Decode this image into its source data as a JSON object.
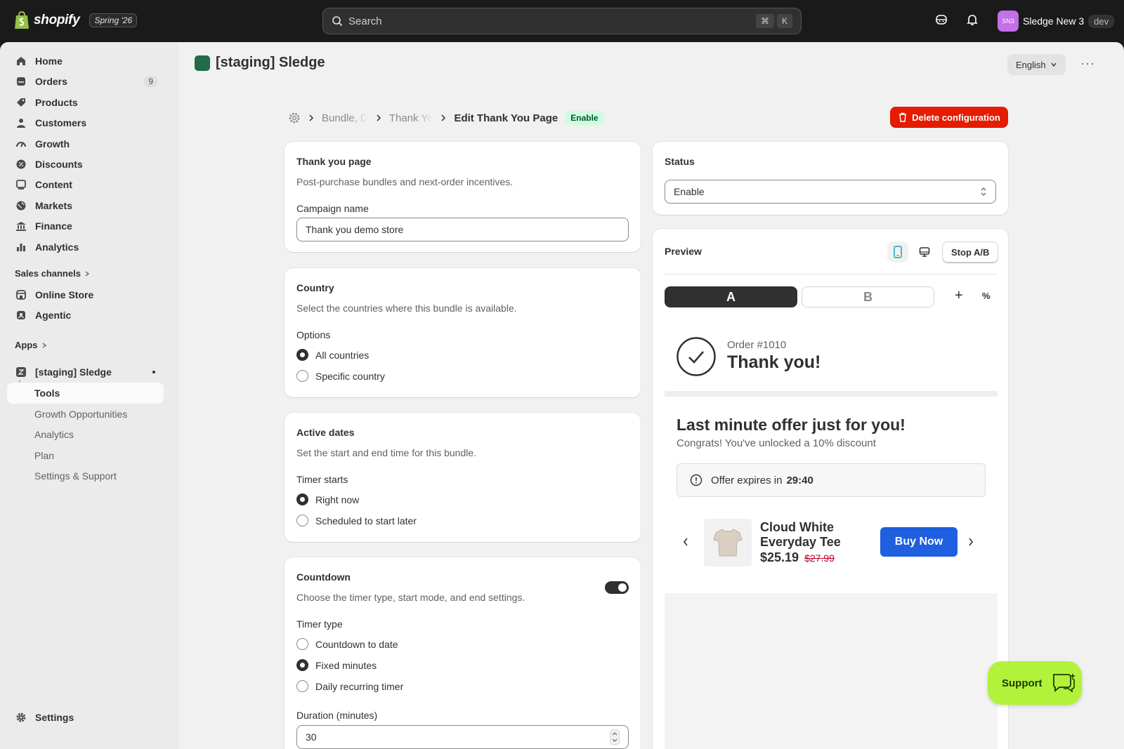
{
  "topbar": {
    "brand": "shopify",
    "edition": "Spring '26",
    "search_placeholder": "Search",
    "shortcut_cmd": "⌘",
    "shortcut_key": "K",
    "user_initials": "SN3",
    "user_name": "Sledge New 3",
    "user_tag": "dev"
  },
  "sidebar": {
    "items": [
      {
        "label": "Home",
        "icon": "home-icon"
      },
      {
        "label": "Orders",
        "icon": "orders-icon",
        "badge": "9"
      },
      {
        "label": "Products",
        "icon": "tag-icon"
      },
      {
        "label": "Customers",
        "icon": "person-icon"
      },
      {
        "label": "Growth",
        "icon": "gauge-icon"
      },
      {
        "label": "Discounts",
        "icon": "discount-icon"
      },
      {
        "label": "Content",
        "icon": "content-icon"
      },
      {
        "label": "Markets",
        "icon": "globe-icon"
      },
      {
        "label": "Finance",
        "icon": "bank-icon"
      },
      {
        "label": "Analytics",
        "icon": "bar-chart-icon"
      }
    ],
    "sales_channels_label": "Sales channels",
    "channels": [
      {
        "label": "Online Store",
        "icon": "store-icon"
      },
      {
        "label": "Agentic",
        "icon": "agentic-icon"
      }
    ],
    "apps_label": "Apps",
    "app_name": "[staging] Sledge",
    "app_subitems": [
      "Tools",
      "Growth Opportunities",
      "Analytics",
      "Plan",
      "Settings & Support"
    ],
    "settings_label": "Settings"
  },
  "header": {
    "app_title": "[staging] Sledge",
    "language": "English",
    "more": "···"
  },
  "breadcrumb": {
    "items": [
      "Bundle, D",
      "Thank Yo"
    ],
    "current": "Edit Thank You Page",
    "status_badge": "Enable",
    "delete_label": "Delete configuration"
  },
  "thankyou_card": {
    "title": "Thank you page",
    "subtitle": "Post-purchase bundles and next-order incentives.",
    "campaign_label": "Campaign name",
    "campaign_value": "Thank you demo store"
  },
  "country_card": {
    "title": "Country",
    "subtitle": "Select the countries where this bundle is available.",
    "options_label": "Options",
    "options": [
      {
        "label": "All countries",
        "selected": true
      },
      {
        "label": "Specific country",
        "selected": false
      }
    ]
  },
  "dates_card": {
    "title": "Active dates",
    "subtitle": "Set the start and end time for this bundle.",
    "timer_label": "Timer starts",
    "options": [
      {
        "label": "Right now",
        "selected": true
      },
      {
        "label": "Scheduled to start later",
        "selected": false
      }
    ]
  },
  "countdown_card": {
    "title": "Countdown",
    "subtitle": "Choose the timer type, start mode, and end settings.",
    "enabled": true,
    "type_label": "Timer type",
    "options": [
      {
        "label": "Countdown to date",
        "selected": false
      },
      {
        "label": "Fixed minutes",
        "selected": true
      },
      {
        "label": "Daily recurring timer",
        "selected": false
      }
    ],
    "duration_label": "Duration (minutes)",
    "duration_value": "30"
  },
  "status_card": {
    "title": "Status",
    "value": "Enable"
  },
  "preview_card": {
    "title": "Preview",
    "stop_ab": "Stop A/B",
    "tab_a": "A",
    "tab_b": "B",
    "add": "+",
    "percent": "%",
    "order_number": "Order #1010",
    "thank_you": "Thank you!",
    "offer_title": "Last minute offer just for you!",
    "offer_subtitle": "Congrats! You've unlocked a 10% discount",
    "expires_prefix": "Offer expires in",
    "expires_time": "29:40",
    "product_name_1": "Cloud White",
    "product_name_2": "Everyday Tee",
    "price": "$25.19",
    "compare_price": "$27.99",
    "buy_label": "Buy Now"
  },
  "support": {
    "label": "Support"
  },
  "colors": {
    "primary_dark": "#303030",
    "danger": "#e51c00",
    "success_bg": "#cdfee1",
    "buy_blue": "#1f5fe0",
    "support_green": "#b3f23b"
  }
}
